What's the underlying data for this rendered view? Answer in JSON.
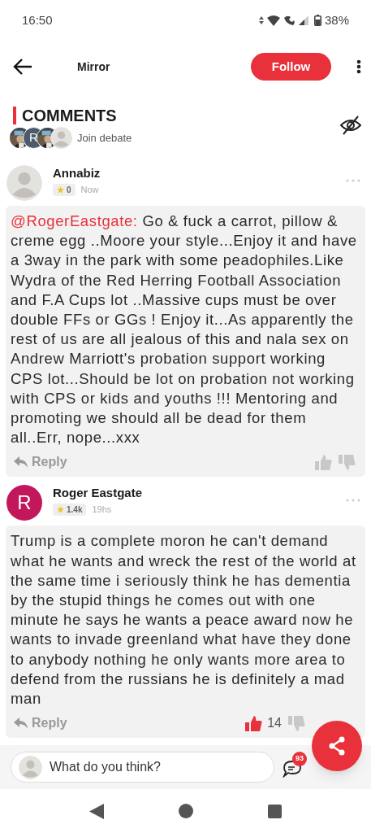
{
  "status_bar": {
    "time": "16:50",
    "battery": "38%"
  },
  "header": {
    "title": "Mirror",
    "follow": "Follow"
  },
  "section": {
    "title": "COMMENTS",
    "join_avatars": [
      {
        "kind": "picture"
      },
      {
        "kind": "letter",
        "letter": "R",
        "color": "#4b5b6b"
      },
      {
        "kind": "picture"
      },
      {
        "kind": "default"
      }
    ],
    "join_label": "Join debate"
  },
  "comments": [
    {
      "author": "Annabiz",
      "avatar": {
        "kind": "default"
      },
      "karma": "0",
      "time": "Now",
      "mention": "@RogerEastgate:",
      "text": "Go & fuck a carrot, pillow & creme egg ..Moore your style...Enjoy it and have a 3way in the park with some peadophiles.Like Wydra of the Red Herring Football Association and F.A Cups lot ..Massive cups must be over double FFs or GGs ! Enjoy it...As apparently the rest of us are all jealous of this and nala sex on Andrew Marriott's probation support working CPS lot...Should be lot on probation not working with CPS or kids and youths !!! Mentoring and promoting we should all be dead for them all..Err, nope...xxx",
      "reply": "Reply",
      "liked": false
    },
    {
      "author": "Roger Eastgate",
      "avatar": {
        "kind": "letter",
        "letter": "R",
        "color": "#c2185b"
      },
      "karma": "1.4k",
      "time": "19hs",
      "text": "Trump is a complete moron he can't demand what he wants and wreck the rest of the world at the same time i seriously think he has dementia by the stupid things he comes out with one minute he says he wants a peace award now he wants to invade greenland what have they done to anybody nothing he only wants more area to defend from the russians he is definitely a mad man",
      "reply": "Reply",
      "liked": true,
      "likes": "14"
    }
  ],
  "composer": {
    "placeholder": "What do you think?",
    "comment_count": "93"
  }
}
